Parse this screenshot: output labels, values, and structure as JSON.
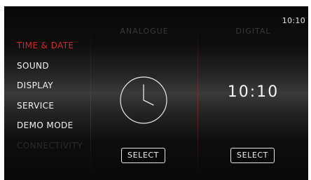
{
  "status_bar": {
    "time": "10:10"
  },
  "menu": {
    "items": [
      {
        "label": "TIME & DATE",
        "state": "active"
      },
      {
        "label": "SOUND",
        "state": "normal"
      },
      {
        "label": "DISPLAY",
        "state": "normal"
      },
      {
        "label": "SERVICE",
        "state": "normal"
      },
      {
        "label": "DEMO MODE",
        "state": "normal"
      },
      {
        "label": "CONNECTIVITY",
        "state": "disabled"
      }
    ]
  },
  "analogue": {
    "header": "ANALOGUE",
    "clock_icon": "analog-clock-icon",
    "select_label": "SELECT"
  },
  "digital": {
    "header": "DIGITAL",
    "time": "10:10",
    "select_label": "SELECT"
  },
  "colors": {
    "accent_red": "#d0282c",
    "text_white": "#f2f2f2",
    "disabled_text": "#2a2a2a",
    "background_dark": "#090909"
  }
}
